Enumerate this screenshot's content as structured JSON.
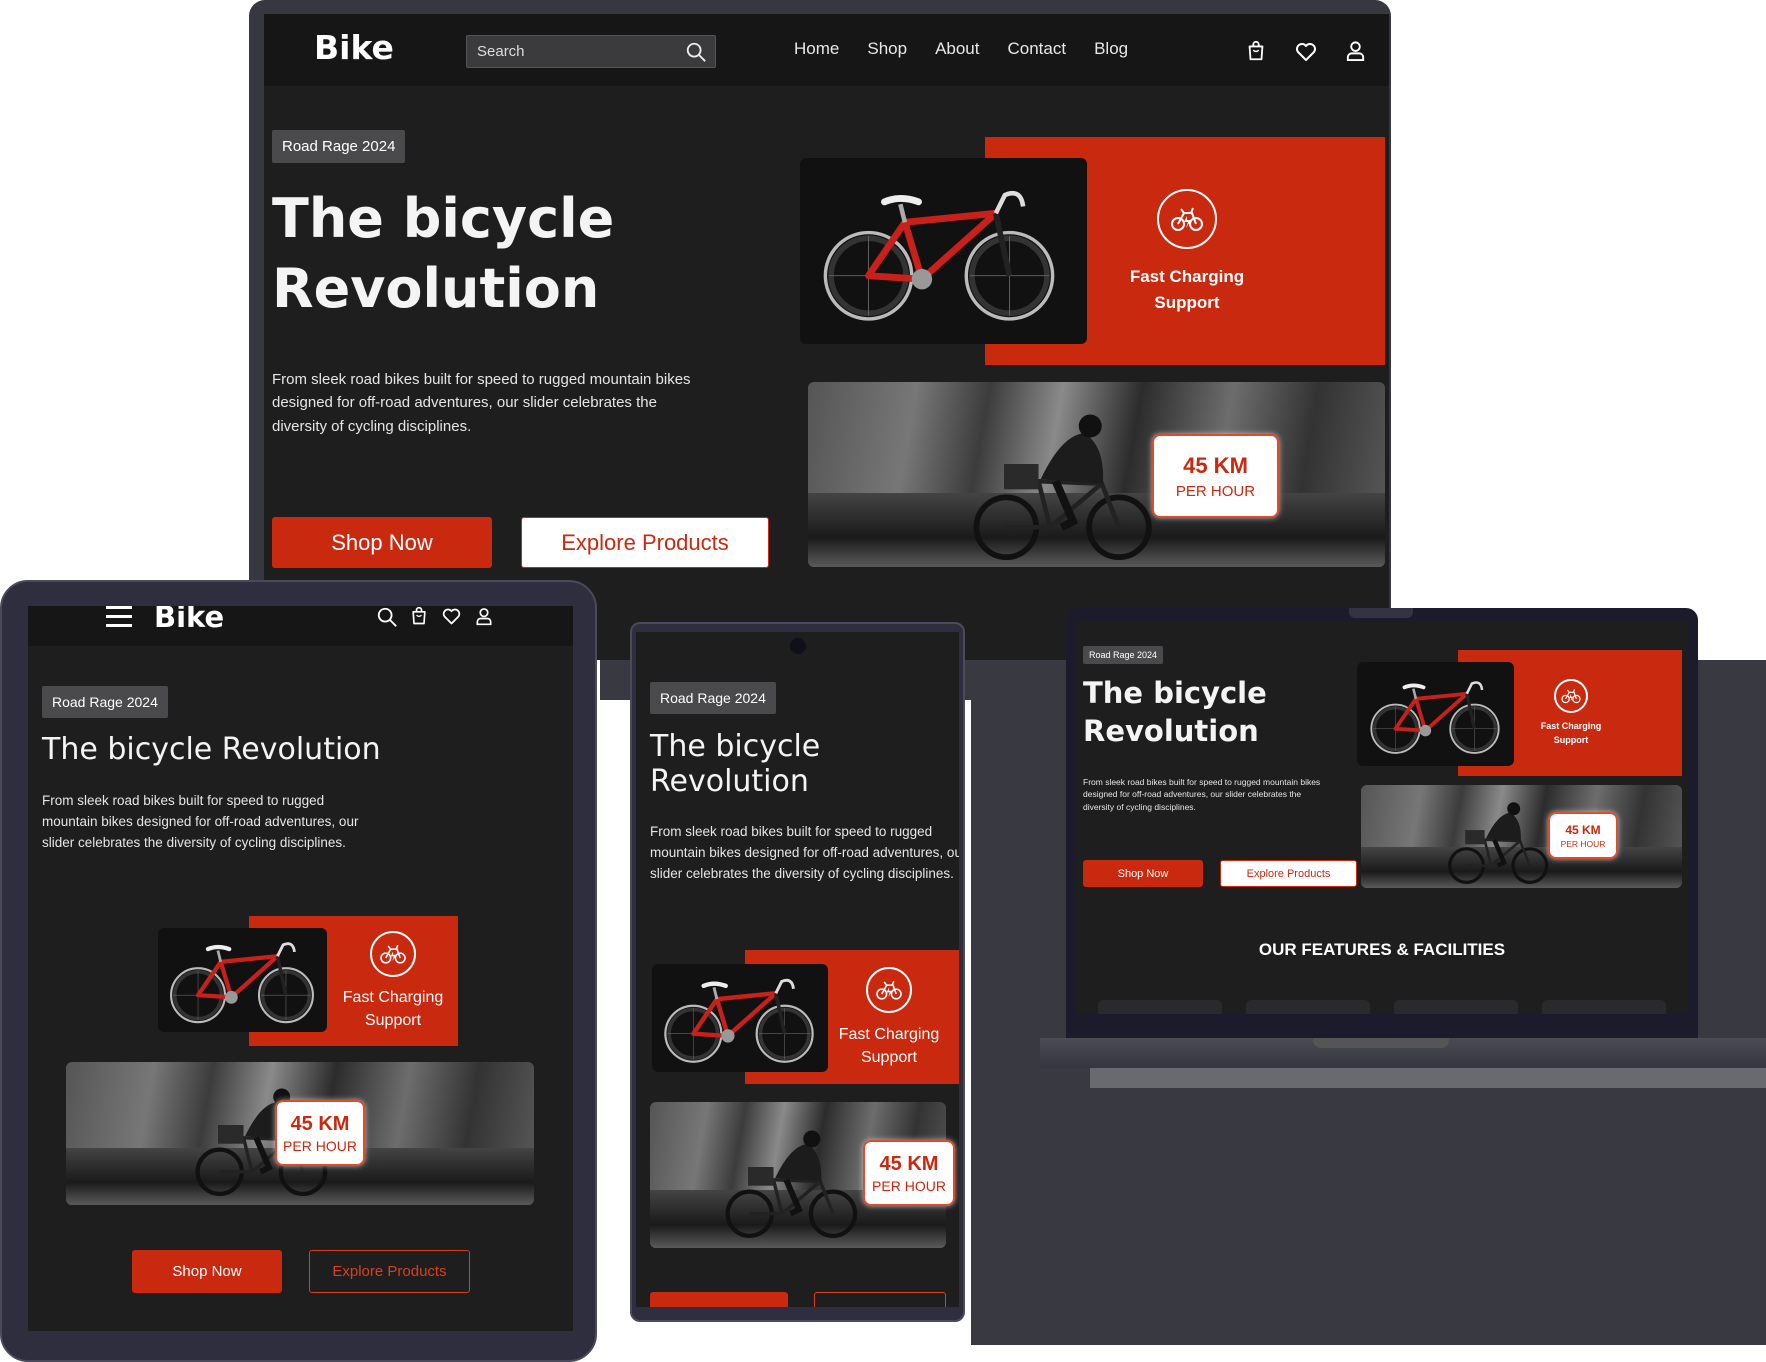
{
  "brand": "Bike",
  "badge": "Road Rage 2024",
  "hero_title": "The bicycle Revolution",
  "hero_title_line1": "The bicycle",
  "hero_title_line2": "Revolution",
  "hero_text": "From sleek road bikes built for speed to rugged mountain bikes designed for off-road adventures, our slider celebrates the diversity of cycling disciplines.",
  "search_placeholder": "Search",
  "nav": [
    "Home",
    "Shop",
    "About",
    "Contact",
    "Blog"
  ],
  "shop_now": "Shop Now",
  "explore_products": "Explore Products",
  "feature_line1": "Fast Charging",
  "feature_line2": "Support",
  "speed_value": "45 KM",
  "speed_unit": "PER HOUR",
  "features_heading": "OUR FEATURES & FACILITIES",
  "colors": {
    "accent": "#c9290f",
    "screen": "#1e1e1f",
    "bezel": "#2d2d38"
  },
  "icons": [
    "search-icon",
    "cart-icon",
    "heart-icon",
    "user-icon",
    "menu-icon",
    "bike-bolt-icon"
  ]
}
